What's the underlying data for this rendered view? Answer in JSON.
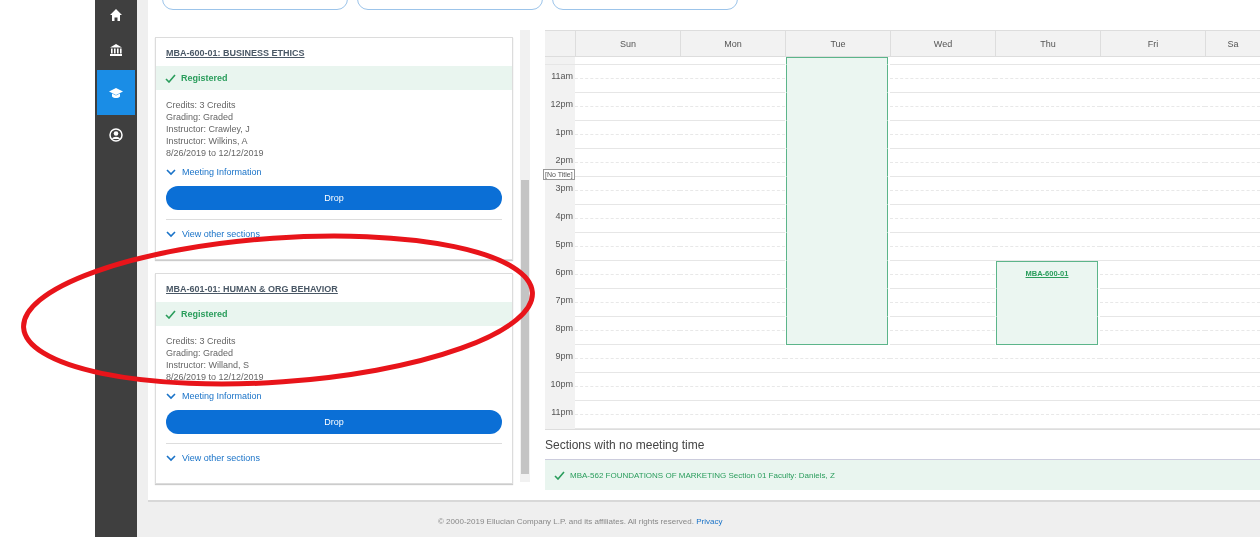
{
  "sidebar": {
    "items": [
      {
        "selected": false
      },
      {
        "selected": false
      },
      {
        "selected": true
      },
      {
        "selected": false
      }
    ]
  },
  "courses": [
    {
      "title": "MBA-600-01: BUSINESS ETHICS",
      "status": "Registered",
      "details": [
        "Credits: 3 Credits",
        "Grading: Graded",
        "Instructor: Crawley, J",
        "Instructor: Wilkins, A",
        "8/26/2019 to 12/12/2019"
      ],
      "meeting_link": "Meeting Information",
      "button": "Drop",
      "sections_link": "View other sections"
    },
    {
      "title": "MBA-601-01: HUMAN & ORG BEHAVIOR",
      "status": "Registered",
      "details": [
        "Credits: 3 Credits",
        "Grading: Graded",
        "Instructor: Willand, S",
        "8/26/2019 to 12/12/2019"
      ],
      "meeting_link": "Meeting Information",
      "button": "Drop",
      "sections_link": "View other sections"
    }
  ],
  "calendar": {
    "days": [
      {
        "label": "Sun"
      },
      {
        "label": "Mon"
      },
      {
        "label": "Tue",
        "booked": [
          true,
          true,
          true,
          true,
          true,
          true,
          true,
          true,
          true,
          true,
          true,
          false,
          false,
          false
        ]
      },
      {
        "label": "Wed"
      },
      {
        "label": "Thu",
        "event_title": "MBA-600-01",
        "booked": [
          false,
          false,
          false,
          false,
          false,
          false,
          false,
          false,
          true,
          true,
          true,
          false,
          false,
          false
        ]
      },
      {
        "label": "Fri"
      },
      {
        "label": "Sa"
      }
    ],
    "hours": [
      "11am",
      "12pm",
      "1pm",
      "2pm",
      "3pm",
      "4pm",
      "5pm",
      "6pm",
      "7pm",
      "8pm",
      "9pm",
      "10pm",
      "11pm"
    ],
    "tooltip": "[No Title]"
  },
  "no_meeting": {
    "heading": "Sections with no meeting time",
    "items": [
      "MBA-562 FOUNDATIONS OF MARKETING Section 01 Faculty: Daniels, Z"
    ]
  },
  "footer": {
    "text": "© 2000-2019 Ellucian Company L.P. and its affiliates. All rights reserved.",
    "link": "Privacy"
  },
  "annotation": {
    "kind": "ellipse"
  }
}
